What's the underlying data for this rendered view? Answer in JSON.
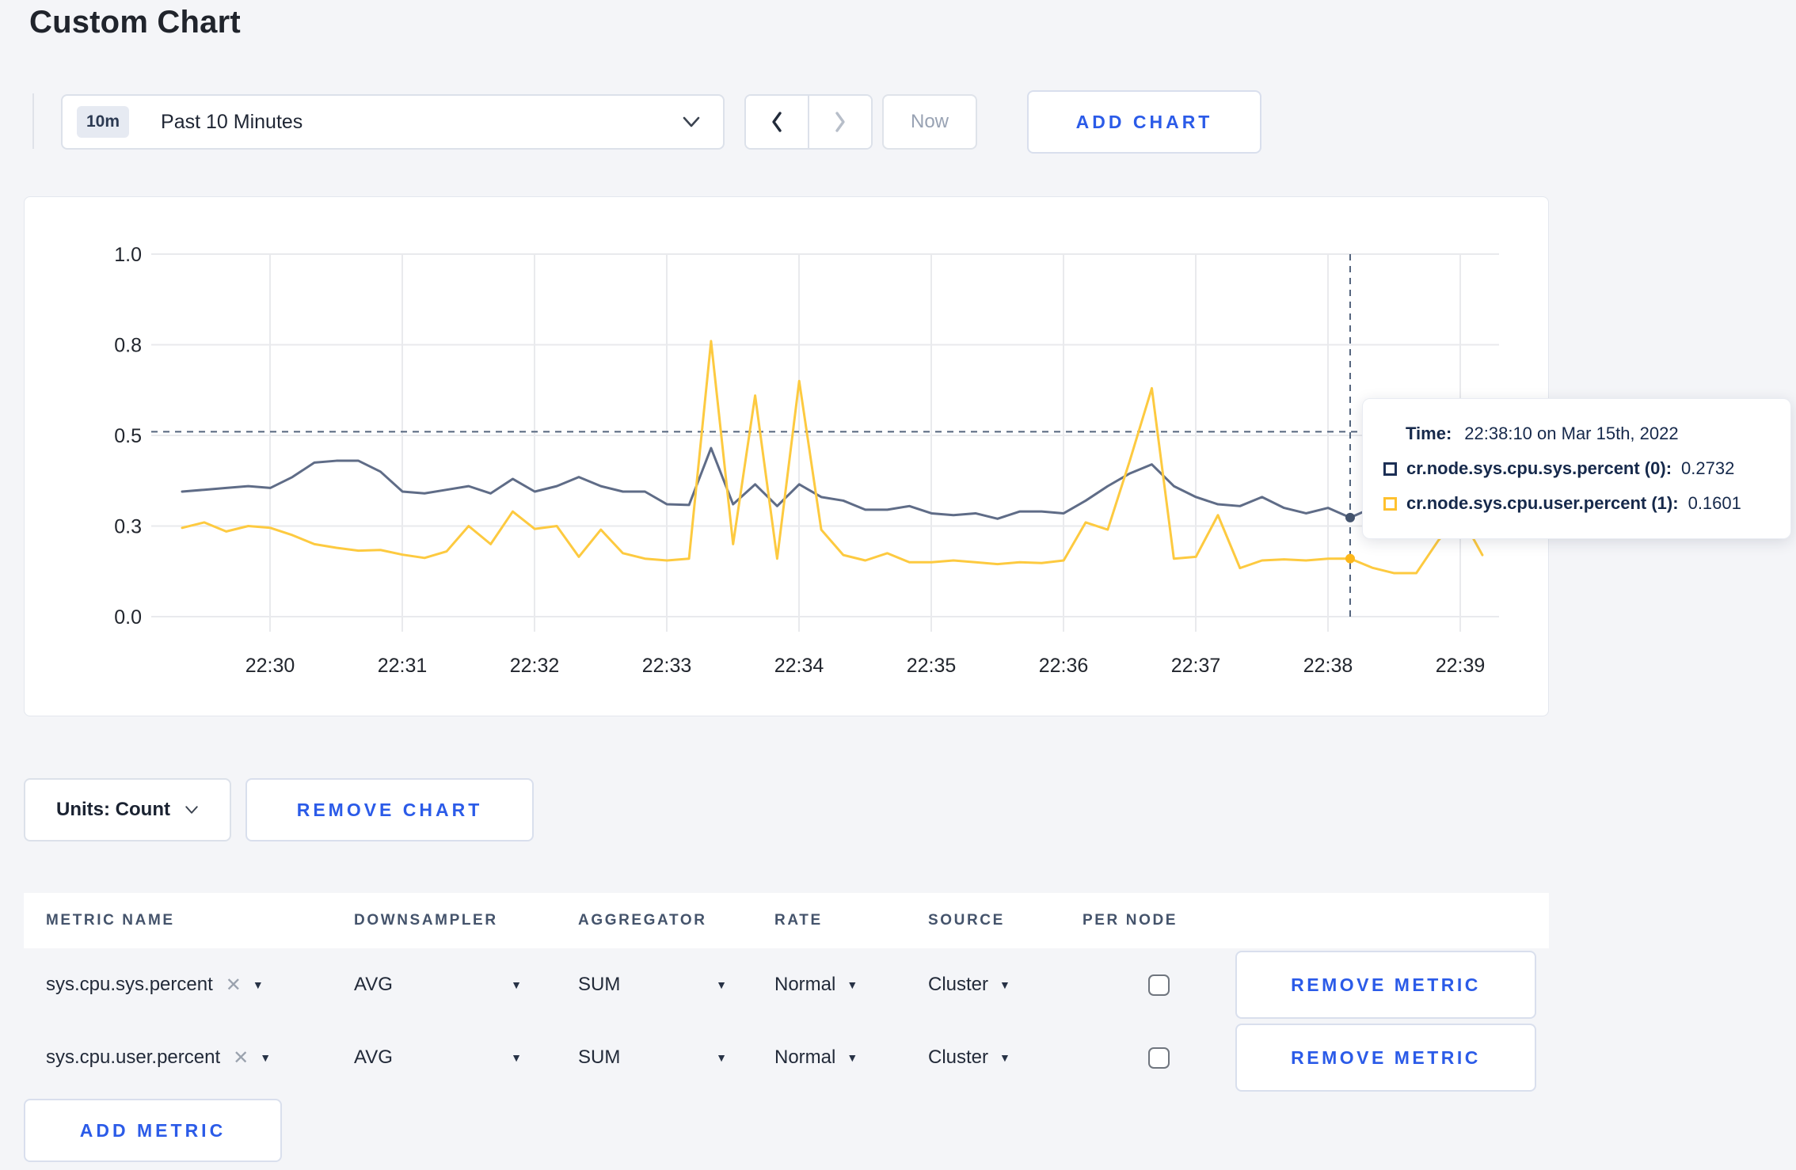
{
  "page": {
    "title": "Custom Chart"
  },
  "toolbar": {
    "time_range": {
      "badge": "10m",
      "label": "Past 10 Minutes"
    },
    "now_label": "Now",
    "add_chart_label": "ADD CHART"
  },
  "chart_data": {
    "type": "line",
    "xlabel": "time",
    "ylabel": "",
    "ylim": [
      0,
      1
    ],
    "grid": true,
    "x_ticks": [
      "22:30",
      "22:31",
      "22:32",
      "22:33",
      "22:34",
      "22:35",
      "22:36",
      "22:37",
      "22:38",
      "22:39"
    ],
    "y_ticks": [
      {
        "value": 0.0,
        "label": "0.0"
      },
      {
        "value": 0.25,
        "label": "0.3"
      },
      {
        "value": 0.5,
        "label": "0.5"
      },
      {
        "value": 0.75,
        "label": "0.8"
      },
      {
        "value": 1.0,
        "label": "1.0"
      }
    ],
    "start_time": "22:29:20",
    "interval_seconds": 10,
    "series": [
      {
        "name": "cr.node.sys.cpu.sys.percent (0)",
        "color": "#5f6c87",
        "values": [
          0.345,
          0.35,
          0.355,
          0.36,
          0.355,
          0.385,
          0.425,
          0.43,
          0.43,
          0.4,
          0.345,
          0.34,
          0.35,
          0.36,
          0.34,
          0.38,
          0.345,
          0.36,
          0.385,
          0.36,
          0.345,
          0.345,
          0.31,
          0.308,
          0.465,
          0.31,
          0.365,
          0.305,
          0.365,
          0.33,
          0.32,
          0.295,
          0.295,
          0.305,
          0.285,
          0.28,
          0.285,
          0.27,
          0.29,
          0.29,
          0.285,
          0.32,
          0.36,
          0.395,
          0.42,
          0.36,
          0.33,
          0.31,
          0.305,
          0.33,
          0.3,
          0.285,
          0.3,
          0.2732,
          0.3,
          0.295,
          0.3,
          0.31,
          0.3,
          0.305
        ]
      },
      {
        "name": "cr.node.sys.cpu.user.percent (1)",
        "color": "#fdca40",
        "values": [
          0.245,
          0.26,
          0.235,
          0.25,
          0.245,
          0.225,
          0.2,
          0.19,
          0.182,
          0.184,
          0.171,
          0.162,
          0.18,
          0.25,
          0.2,
          0.29,
          0.242,
          0.25,
          0.165,
          0.24,
          0.175,
          0.16,
          0.155,
          0.16,
          0.76,
          0.2,
          0.61,
          0.16,
          0.65,
          0.24,
          0.17,
          0.155,
          0.175,
          0.15,
          0.15,
          0.155,
          0.15,
          0.145,
          0.15,
          0.148,
          0.155,
          0.26,
          0.24,
          0.43,
          0.63,
          0.16,
          0.165,
          0.28,
          0.134,
          0.155,
          0.158,
          0.155,
          0.16,
          0.1601,
          0.135,
          0.12,
          0.12,
          0.21,
          0.28,
          0.17
        ]
      }
    ],
    "crosshair": {
      "time": "22:38:10",
      "offset_seconds": 530,
      "hline_value": 0.51,
      "points": [
        {
          "value": 0.2732,
          "color": "#44546e"
        },
        {
          "value": 0.1601,
          "color": "#fdb71a"
        }
      ]
    }
  },
  "tooltip": {
    "time_label": "Time:",
    "time_value": "22:38:10 on Mar 15th, 2022",
    "rows": [
      {
        "label": "cr.node.sys.cpu.sys.percent (0):",
        "value": "0.2732",
        "swatch_color": "#1c2f55"
      },
      {
        "label": "cr.node.sys.cpu.user.percent (1):",
        "value": "0.1601",
        "swatch_color": "#ffc12e"
      }
    ]
  },
  "chart_controls": {
    "units_label": "Units: Count",
    "remove_chart_label": "REMOVE CHART"
  },
  "metrics_table": {
    "headers": [
      "METRIC NAME",
      "DOWNSAMPLER",
      "AGGREGATOR",
      "RATE",
      "SOURCE",
      "PER NODE"
    ],
    "rows": [
      {
        "metric": "sys.cpu.sys.percent",
        "downsampler": "AVG",
        "aggregator": "SUM",
        "rate": "Normal",
        "source": "Cluster",
        "per_node_checked": false,
        "remove_label": "REMOVE METRIC"
      },
      {
        "metric": "sys.cpu.user.percent",
        "downsampler": "AVG",
        "aggregator": "SUM",
        "rate": "Normal",
        "source": "Cluster",
        "per_node_checked": false,
        "remove_label": "REMOVE METRIC"
      }
    ],
    "add_metric_label": "ADD METRIC"
  },
  "icons": {
    "caret_down": "▼",
    "close": "✕"
  },
  "colors": {
    "accent_blue": "#2b5be8",
    "series_sys": "#5f6c87",
    "series_user": "#fdca40",
    "crosshair": "#54657e"
  }
}
